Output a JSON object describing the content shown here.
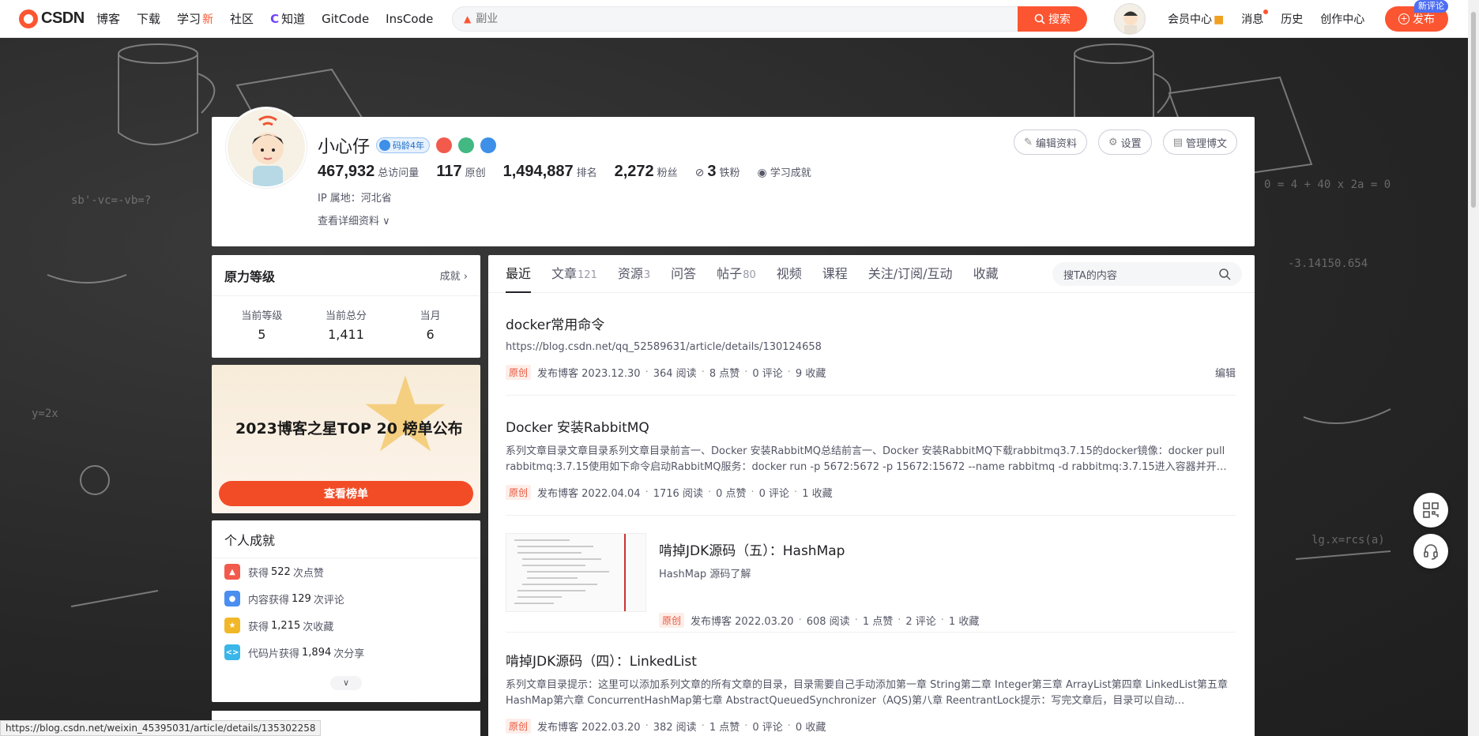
{
  "topnav": {
    "logo": "CSDN",
    "items": [
      {
        "label": "博客"
      },
      {
        "label": "下载"
      },
      {
        "label": "学习",
        "badge": "新"
      },
      {
        "label": "社区"
      },
      {
        "label": "知道"
      },
      {
        "label": "GitCode"
      },
      {
        "label": "InsCode"
      }
    ],
    "search_placeholder": "副业",
    "search_button": "搜索",
    "right_links": [
      "会员中心",
      "消息",
      "历史",
      "创作中心"
    ],
    "publish": "发布",
    "new_comment": "新评论"
  },
  "profile": {
    "name": "小心仔",
    "code_age": "码龄4年",
    "stats": [
      {
        "value": "467,932",
        "label": "总访问量"
      },
      {
        "value": "117",
        "label": "原创"
      },
      {
        "value": "1,494,887",
        "label": "排名"
      },
      {
        "value": "2,272",
        "label": "粉丝"
      },
      {
        "value": "3",
        "label": "铁粉"
      }
    ],
    "learn": "学习成就",
    "ip": "IP 属地：河北省",
    "more": "查看详细资料",
    "buttons": [
      "编辑资料",
      "设置",
      "管理博文"
    ]
  },
  "force": {
    "title": "原力等级",
    "more": "成就",
    "cols": [
      {
        "label": "当前等级",
        "value": "5"
      },
      {
        "label": "当前总分",
        "value": "1,411"
      },
      {
        "label": "当月",
        "value": "6"
      }
    ]
  },
  "promo": {
    "title": "2023博客之星TOP 20 榜单公布",
    "button": "查看榜单"
  },
  "achievements": {
    "title": "个人成就",
    "items": [
      {
        "pre": "获得",
        "num": "522",
        "post": "次点赞",
        "color": "#f25a4c"
      },
      {
        "pre": "内容获得",
        "num": "129",
        "post": "次评论",
        "color": "#4a8ef0"
      },
      {
        "pre": "获得",
        "num": "1,215",
        "post": "次收藏",
        "color": "#f2b728"
      },
      {
        "pre": "代码片获得",
        "num": "1,894",
        "post": "次分享",
        "color": "#3ab6e8"
      }
    ]
  },
  "tabs": [
    {
      "label": "最近",
      "count": ""
    },
    {
      "label": "文章",
      "count": "121"
    },
    {
      "label": "资源",
      "count": "3"
    },
    {
      "label": "问答",
      "count": ""
    },
    {
      "label": "帖子",
      "count": "80"
    },
    {
      "label": "视频",
      "count": ""
    },
    {
      "label": "课程",
      "count": ""
    },
    {
      "label": "关注/订阅/互动",
      "count": ""
    },
    {
      "label": "收藏",
      "count": ""
    }
  ],
  "tab_search": "搜TA的内容",
  "articles": [
    {
      "title": "docker常用命令",
      "desc": "https://blog.csdn.net/qq_52589631/article/details/130124658",
      "tag": "原创",
      "date": "发布博客 2023.12.30",
      "reads": "364 阅读",
      "likes": "8 点赞",
      "comments": "0 评论",
      "favs": "9 收藏",
      "edit": "编辑"
    },
    {
      "title": "Docker 安装RabbitMQ",
      "desc": "系列文章目录文章目录系列文章目录前言一、Docker 安装RabbitMQ总结前言一、Docker 安装RabbitMQ下载rabbitmq3.7.15的docker镜像：docker pull rabbitmq:3.7.15使用如下命令启动RabbitMQ服务：docker run -p 5672:5672 -p 15672:15672 --name rabbitmq -d rabbitmq:3.7.15进入容器并开…",
      "tag": "原创",
      "date": "发布博客 2022.04.04",
      "reads": "1716 阅读",
      "likes": "0 点赞",
      "comments": "0 评论",
      "favs": "1 收藏"
    },
    {
      "title": "啃掉JDK源码（五）：HashMap",
      "desc": "HashMap 源码了解",
      "tag": "原创",
      "date": "发布博客 2022.03.20",
      "reads": "608 阅读",
      "likes": "1 点赞",
      "comments": "2 评论",
      "favs": "1 收藏"
    },
    {
      "title": "啃掉JDK源码（四）：LinkedList",
      "desc": "系列文章目录提示：这里可以添加系列文章的所有文章的目录，目录需要自己手动添加第一章 String第二章 Integer第三章 ArrayList第四章 LinkedList第五章 HashMap第六章 ConcurrentHashMap第七章 AbstractQueuedSynchronizer（AQS)第八章 ReentrantLock提示：写完文章后，目录可以自动…",
      "tag": "原创",
      "date": "发布博客 2022.03.20",
      "reads": "382 阅读",
      "likes": "1 点赞",
      "comments": "0 评论",
      "favs": "0 收藏"
    }
  ],
  "status_url": "https://blog.csdn.net/weixin_45395031/article/details/135302258",
  "colors": {
    "brand": "#fc5531",
    "text": "#222226",
    "muted": "#555666"
  }
}
